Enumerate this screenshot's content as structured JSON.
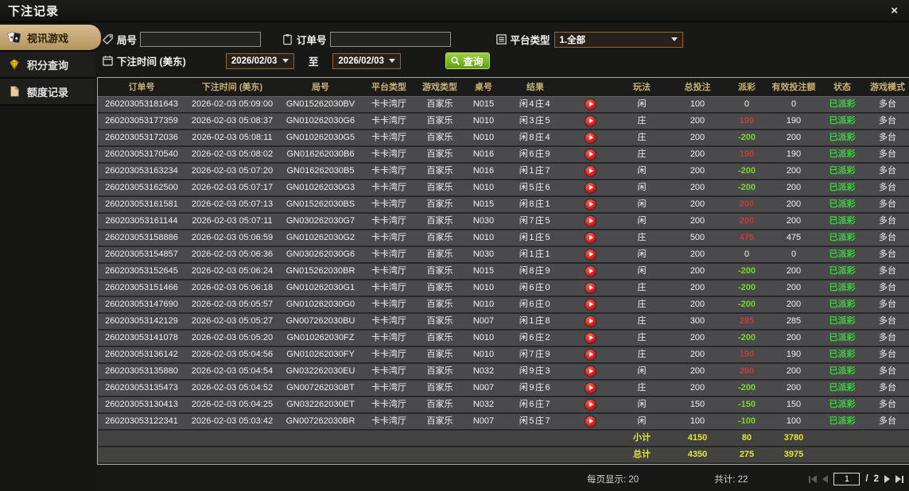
{
  "window": {
    "title": "下注记录",
    "close_label": "×"
  },
  "sidebar": {
    "items": [
      {
        "label": "视讯游戏"
      },
      {
        "label": "积分查询"
      },
      {
        "label": "额度记录"
      }
    ]
  },
  "filters": {
    "round_label": "局号",
    "order_label": "订单号",
    "platform_label": "平台类型",
    "platform_value": "1.全部",
    "time_label": "下注时间 (美东)",
    "date_from": "2026/02/03",
    "to_label": "至",
    "date_to": "2026/02/03",
    "query_label": "查询"
  },
  "colors": {
    "accent_tan": "#c9ad80",
    "header_gold": "#c9b176",
    "win_red": "#c43b3b",
    "loss_green": "#7ed428",
    "total_yellow": "#e5e532",
    "status_green": "#36d336",
    "query_green": "#7ab82a"
  },
  "table": {
    "headers": {
      "order": "订单号",
      "time": "下注时间 (美东)",
      "round": "局号",
      "platform": "平台类型",
      "game": "游戏类型",
      "table_no": "桌号",
      "result": "结果",
      "replay": "",
      "play": "玩法",
      "total_bet": "总投注",
      "payout": "派彩",
      "valid_bet": "有效投注额",
      "status": "状态",
      "mode": "游戏模式"
    },
    "rows": [
      {
        "order": "260203053181643",
        "time": "2026-02-03 05:09:00",
        "round": "GN015262030BV",
        "platform": "卡卡湾厅",
        "game": "百家乐",
        "table_no": "N015",
        "result": "闲4庄4",
        "play": "闲",
        "total_bet": "100",
        "payout": "0",
        "payout_color": "zero",
        "valid_bet": "0",
        "status": "已派彩",
        "mode": "多台"
      },
      {
        "order": "260203053177359",
        "time": "2026-02-03 05:08:37",
        "round": "GN010262030G6",
        "platform": "卡卡湾厅",
        "game": "百家乐",
        "table_no": "N010",
        "result": "闲3庄5",
        "play": "庄",
        "total_bet": "200",
        "payout": "190",
        "payout_color": "pos",
        "valid_bet": "190",
        "status": "已派彩",
        "mode": "多台"
      },
      {
        "order": "260203053172036",
        "time": "2026-02-03 05:08:11",
        "round": "GN010262030G5",
        "platform": "卡卡湾厅",
        "game": "百家乐",
        "table_no": "N010",
        "result": "闲8庄4",
        "play": "庄",
        "total_bet": "200",
        "payout": "-200",
        "payout_color": "neg",
        "valid_bet": "200",
        "status": "已派彩",
        "mode": "多台"
      },
      {
        "order": "260203053170540",
        "time": "2026-02-03 05:08:02",
        "round": "GN016262030B6",
        "platform": "卡卡湾厅",
        "game": "百家乐",
        "table_no": "N016",
        "result": "闲6庄9",
        "play": "庄",
        "total_bet": "200",
        "payout": "190",
        "payout_color": "pos",
        "valid_bet": "190",
        "status": "已派彩",
        "mode": "多台"
      },
      {
        "order": "260203053163234",
        "time": "2026-02-03 05:07:20",
        "round": "GN016262030B5",
        "platform": "卡卡湾厅",
        "game": "百家乐",
        "table_no": "N016",
        "result": "闲1庄7",
        "play": "闲",
        "total_bet": "200",
        "payout": "-200",
        "payout_color": "neg",
        "valid_bet": "200",
        "status": "已派彩",
        "mode": "多台"
      },
      {
        "order": "260203053162500",
        "time": "2026-02-03 05:07:17",
        "round": "GN010262030G3",
        "platform": "卡卡湾厅",
        "game": "百家乐",
        "table_no": "N010",
        "result": "闲5庄6",
        "play": "闲",
        "total_bet": "200",
        "payout": "-200",
        "payout_color": "neg",
        "valid_bet": "200",
        "status": "已派彩",
        "mode": "多台"
      },
      {
        "order": "260203053161581",
        "time": "2026-02-03 05:07:13",
        "round": "GN015262030BS",
        "platform": "卡卡湾厅",
        "game": "百家乐",
        "table_no": "N015",
        "result": "闲8庄1",
        "play": "闲",
        "total_bet": "200",
        "payout": "200",
        "payout_color": "pos",
        "valid_bet": "200",
        "status": "已派彩",
        "mode": "多台"
      },
      {
        "order": "260203053161144",
        "time": "2026-02-03 05:07:11",
        "round": "GN030262030G7",
        "platform": "卡卡湾厅",
        "game": "百家乐",
        "table_no": "N030",
        "result": "闲7庄5",
        "play": "闲",
        "total_bet": "200",
        "payout": "200",
        "payout_color": "pos",
        "valid_bet": "200",
        "status": "已派彩",
        "mode": "多台"
      },
      {
        "order": "260203053158886",
        "time": "2026-02-03 05:06:59",
        "round": "GN010262030G2",
        "platform": "卡卡湾厅",
        "game": "百家乐",
        "table_no": "N010",
        "result": "闲1庄5",
        "play": "庄",
        "total_bet": "500",
        "payout": "475",
        "payout_color": "pos",
        "valid_bet": "475",
        "status": "已派彩",
        "mode": "多台"
      },
      {
        "order": "260203053154857",
        "time": "2026-02-03 05:06:36",
        "round": "GN030262030G6",
        "platform": "卡卡湾厅",
        "game": "百家乐",
        "table_no": "N030",
        "result": "闲1庄1",
        "play": "闲",
        "total_bet": "200",
        "payout": "0",
        "payout_color": "zero",
        "valid_bet": "0",
        "status": "已派彩",
        "mode": "多台"
      },
      {
        "order": "260203053152645",
        "time": "2026-02-03 05:06:24",
        "round": "GN015262030BR",
        "platform": "卡卡湾厅",
        "game": "百家乐",
        "table_no": "N015",
        "result": "闲8庄9",
        "play": "闲",
        "total_bet": "200",
        "payout": "-200",
        "payout_color": "neg",
        "valid_bet": "200",
        "status": "已派彩",
        "mode": "多台"
      },
      {
        "order": "260203053151466",
        "time": "2026-02-03 05:06:18",
        "round": "GN010262030G1",
        "platform": "卡卡湾厅",
        "game": "百家乐",
        "table_no": "N010",
        "result": "闲6庄0",
        "play": "庄",
        "total_bet": "200",
        "payout": "-200",
        "payout_color": "neg",
        "valid_bet": "200",
        "status": "已派彩",
        "mode": "多台"
      },
      {
        "order": "260203053147690",
        "time": "2026-02-03 05:05:57",
        "round": "GN010262030G0",
        "platform": "卡卡湾厅",
        "game": "百家乐",
        "table_no": "N010",
        "result": "闲6庄0",
        "play": "庄",
        "total_bet": "200",
        "payout": "-200",
        "payout_color": "neg",
        "valid_bet": "200",
        "status": "已派彩",
        "mode": "多台"
      },
      {
        "order": "260203053142129",
        "time": "2026-02-03 05:05:27",
        "round": "GN007262030BU",
        "platform": "卡卡湾厅",
        "game": "百家乐",
        "table_no": "N007",
        "result": "闲1庄8",
        "play": "庄",
        "total_bet": "300",
        "payout": "285",
        "payout_color": "pos",
        "valid_bet": "285",
        "status": "已派彩",
        "mode": "多台"
      },
      {
        "order": "260203053141078",
        "time": "2026-02-03 05:05:20",
        "round": "GN010262030FZ",
        "platform": "卡卡湾厅",
        "game": "百家乐",
        "table_no": "N010",
        "result": "闲6庄2",
        "play": "庄",
        "total_bet": "200",
        "payout": "-200",
        "payout_color": "neg",
        "valid_bet": "200",
        "status": "已派彩",
        "mode": "多台"
      },
      {
        "order": "260203053136142",
        "time": "2026-02-03 05:04:56",
        "round": "GN010262030FY",
        "platform": "卡卡湾厅",
        "game": "百家乐",
        "table_no": "N010",
        "result": "闲7庄9",
        "play": "庄",
        "total_bet": "200",
        "payout": "190",
        "payout_color": "pos",
        "valid_bet": "190",
        "status": "已派彩",
        "mode": "多台"
      },
      {
        "order": "260203053135880",
        "time": "2026-02-03 05:04:54",
        "round": "GN032262030EU",
        "platform": "卡卡湾厅",
        "game": "百家乐",
        "table_no": "N032",
        "result": "闲9庄3",
        "play": "闲",
        "total_bet": "200",
        "payout": "200",
        "payout_color": "pos",
        "valid_bet": "200",
        "status": "已派彩",
        "mode": "多台"
      },
      {
        "order": "260203053135473",
        "time": "2026-02-03 05:04:52",
        "round": "GN007262030BT",
        "platform": "卡卡湾厅",
        "game": "百家乐",
        "table_no": "N007",
        "result": "闲9庄6",
        "play": "庄",
        "total_bet": "200",
        "payout": "-200",
        "payout_color": "neg",
        "valid_bet": "200",
        "status": "已派彩",
        "mode": "多台"
      },
      {
        "order": "260203053130413",
        "time": "2026-02-03 05:04:25",
        "round": "GN032262030ET",
        "platform": "卡卡湾厅",
        "game": "百家乐",
        "table_no": "N032",
        "result": "闲6庄7",
        "play": "闲",
        "total_bet": "150",
        "payout": "-150",
        "payout_color": "neg",
        "valid_bet": "150",
        "status": "已派彩",
        "mode": "多台"
      },
      {
        "order": "260203053122341",
        "time": "2026-02-03 05:03:42",
        "round": "GN007262030BR",
        "platform": "卡卡湾厅",
        "game": "百家乐",
        "table_no": "N007",
        "result": "闲5庄7",
        "play": "闲",
        "total_bet": "100",
        "payout": "-100",
        "payout_color": "neg",
        "valid_bet": "100",
        "status": "已派彩",
        "mode": "多台"
      }
    ],
    "subtotal": {
      "label": "小计",
      "total_bet": "4150",
      "payout": "80",
      "valid_bet": "3780"
    },
    "total": {
      "label": "总计",
      "total_bet": "4350",
      "payout": "275",
      "valid_bet": "3975"
    }
  },
  "pagination": {
    "per_page_label": "每页显示:",
    "per_page_value": "20",
    "total_label": "共计:",
    "total_value": "22",
    "current_page": "1",
    "page_separator": "/",
    "page_count": "2"
  }
}
